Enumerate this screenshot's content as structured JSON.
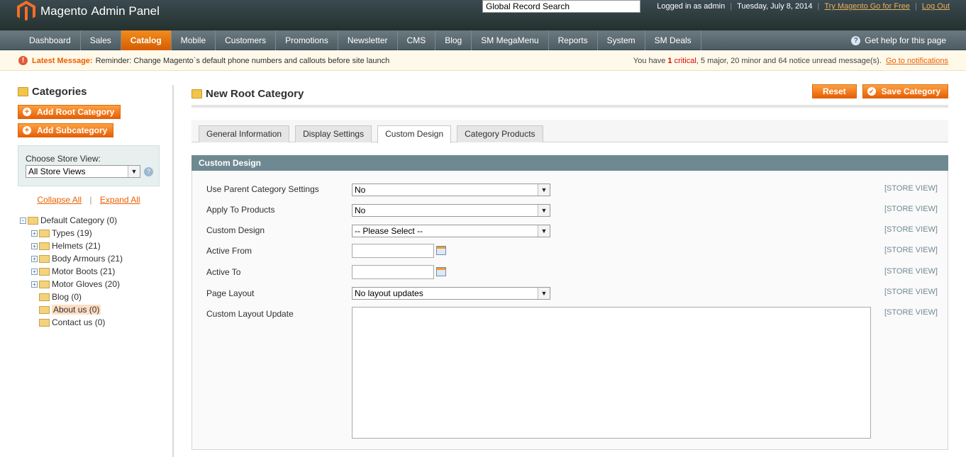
{
  "header": {
    "logo_brand": "Magento",
    "logo_suffix": "Admin Panel",
    "search_value": "Global Record Search",
    "logged_in": "Logged in as admin",
    "date": "Tuesday, July 8, 2014",
    "try_link": "Try Magento Go for Free",
    "logout": "Log Out"
  },
  "nav": {
    "items": [
      "Dashboard",
      "Sales",
      "Catalog",
      "Mobile",
      "Customers",
      "Promotions",
      "Newsletter",
      "CMS",
      "Blog",
      "SM MegaMenu",
      "Reports",
      "System",
      "SM Deals"
    ],
    "active": "Catalog",
    "help": "Get help for this page"
  },
  "notice": {
    "label": "Latest Message:",
    "text": "Reminder: Change Magento`s default phone numbers and callouts before site launch",
    "prefix": "You have",
    "critical_count": "1",
    "critical_label": "critical",
    "rest": ", 5 major, 20 minor and 64 notice unread message(s).",
    "link": "Go to notifications"
  },
  "side": {
    "title": "Categories",
    "add_root": "Add Root Category",
    "add_sub": "Add Subcategory",
    "store_label": "Choose Store View:",
    "store_value": "All Store Views",
    "collapse_all": "Collapse All",
    "expand_all": "Expand All",
    "tree": {
      "root": "Default Category (0)",
      "children": [
        "Types (19)",
        "Helmets (21)",
        "Body Armours (21)",
        "Motor Boots (21)",
        "Motor Gloves (20)",
        "Blog (0)",
        "About us (0)",
        "Contact us (0)"
      ]
    }
  },
  "main": {
    "title": "New Root Category",
    "reset": "Reset",
    "save": "Save Category",
    "tabs": [
      "General Information",
      "Display Settings",
      "Custom Design",
      "Category Products"
    ],
    "active_tab": "Custom Design",
    "section": "Custom Design",
    "scope": "[STORE VIEW]",
    "fields": {
      "use_parent_label": "Use Parent Category Settings",
      "use_parent_value": "No",
      "apply_products_label": "Apply To Products",
      "apply_products_value": "No",
      "custom_design_label": "Custom Design",
      "custom_design_value": "-- Please Select --",
      "active_from_label": "Active From",
      "active_to_label": "Active To",
      "page_layout_label": "Page Layout",
      "page_layout_value": "No layout updates",
      "layout_update_label": "Custom Layout Update"
    }
  }
}
